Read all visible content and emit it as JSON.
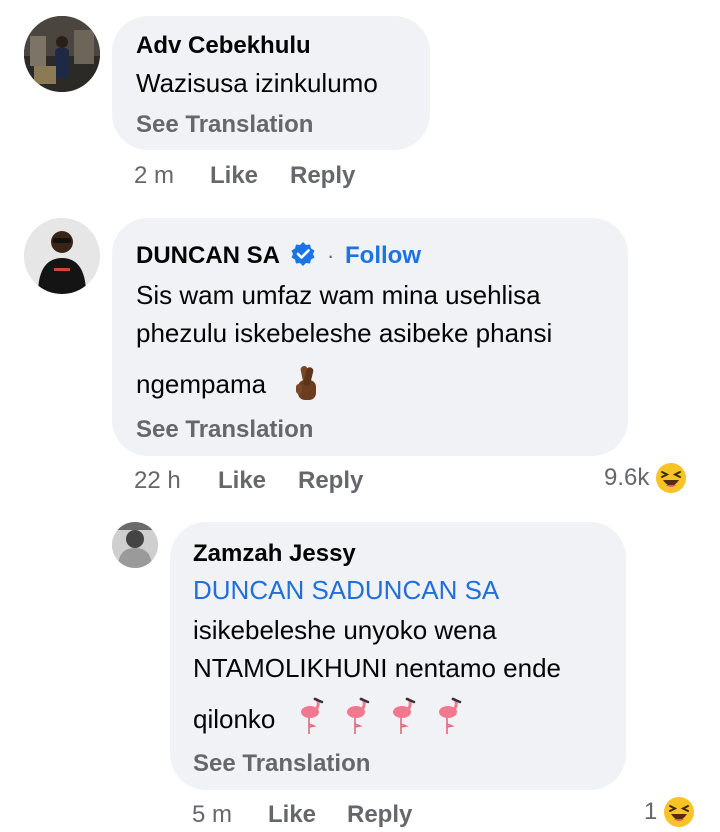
{
  "comments": [
    {
      "author": "Adv Cebekhulu",
      "text": "Wazisusa izinkulumo",
      "see_translation": "See Translation",
      "time": "2 m",
      "like": "Like",
      "reply": "Reply"
    },
    {
      "author": "DUNCAN SA",
      "verified_icon": "verified-badge-icon",
      "follow": "Follow",
      "text_line1": "Sis wam umfaz wam mina usehlisa",
      "text_line2": "phezulu iskebeleshe asibeke phansi",
      "text_line3": "ngempama",
      "emoji": "crossed-fingers-icon",
      "see_translation": "See Translation",
      "time": "22 h",
      "like": "Like",
      "reply": "Reply",
      "reaction_count": "9.6k",
      "reaction_icon": "laughing-emoji-icon"
    },
    {
      "author": "Zamzah Jessy",
      "mention": "DUNCAN SADUNCAN SA",
      "text_line1": "isikebeleshe unyoko wena",
      "text_line2": "NTAMOLIKHUNI nentamo ende",
      "text_line3": "qilonko",
      "emoji": "flamingo-icon",
      "emoji_count": 4,
      "see_translation": "See Translation",
      "time": "5 m",
      "like": "Like",
      "reply": "Reply",
      "reaction_count": "1",
      "reaction_icon": "laughing-emoji-icon"
    }
  ],
  "colors": {
    "bubble": "#f0f2f5",
    "link_blue": "#1b74e4",
    "secondary_text": "#65676b",
    "primary_text": "#050505"
  }
}
